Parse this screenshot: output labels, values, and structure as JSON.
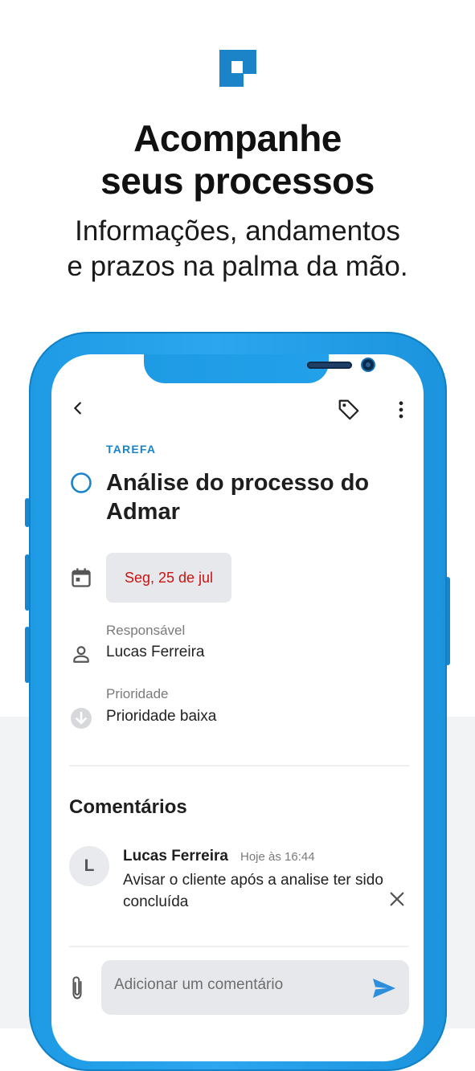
{
  "promo": {
    "headline_line1": "Acompanhe",
    "headline_line2": "seus processos",
    "subheadline_line1": "Informações, andamentos",
    "subheadline_line2": "e prazos na palma da mão."
  },
  "colors": {
    "brand_blue": "#1b83c8",
    "phone_blue": "#1e9be4",
    "date_red": "#cc1111",
    "chip_gray": "#e6e8eb",
    "send_blue": "#2d8fdc"
  },
  "toolbar": {
    "back_icon": "chevron-left-icon",
    "tag_icon": "tag-icon",
    "more_icon": "more-vertical-icon"
  },
  "task": {
    "type_label": "TAREFA",
    "title": "Análise do processo do Admar",
    "status_icon": "circle-outline-icon",
    "date_icon": "calendar-icon",
    "date": "Seg, 25 de jul",
    "responsible_label": "Responsável",
    "responsible_value": "Lucas Ferreira",
    "responsible_icon": "person-icon",
    "priority_label": "Prioridade",
    "priority_value": "Prioridade baixa",
    "priority_icon": "arrow-down-circle-icon"
  },
  "comments": {
    "title": "Comentários",
    "items": [
      {
        "avatar_initial": "L",
        "author": "Lucas Ferreira",
        "time": "Hoje às 16:44",
        "text": "Avisar o cliente após a analise ter sido concluída"
      }
    ],
    "input_placeholder": "Adicionar um comentário",
    "attach_icon": "paperclip-icon",
    "send_icon": "send-icon",
    "delete_icon": "close-icon"
  }
}
